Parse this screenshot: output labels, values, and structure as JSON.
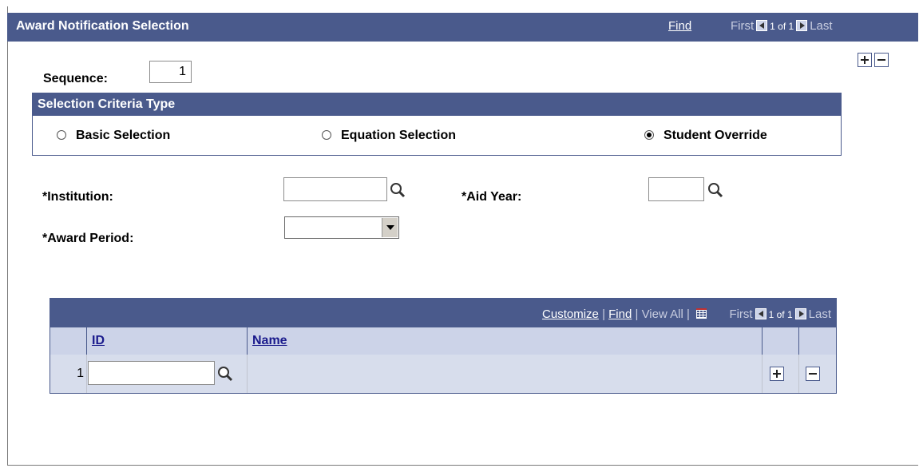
{
  "header": {
    "title": "Award Notification Selection",
    "find": "Find",
    "first": "First",
    "count": "1 of 1",
    "last": "Last"
  },
  "sequence": {
    "label": "Sequence:",
    "value": "1"
  },
  "criteria": {
    "title": "Selection Criteria Type",
    "options": [
      {
        "label": "Basic Selection",
        "selected": false
      },
      {
        "label": "Equation Selection",
        "selected": false
      },
      {
        "label": "Student Override",
        "selected": true
      }
    ]
  },
  "form": {
    "institution_label": "*Institution:",
    "institution_value": "",
    "aid_year_label": "*Aid Year:",
    "aid_year_value": "",
    "award_period_label": "*Award Period:",
    "award_period_value": ""
  },
  "grid": {
    "customize": "Customize",
    "find": "Find",
    "view_all": "View All",
    "first": "First",
    "count": "1 of 1",
    "last": "Last",
    "columns": {
      "id": "ID",
      "name": "Name"
    },
    "rows": [
      {
        "num": "1",
        "id": "",
        "name": ""
      }
    ]
  },
  "colors": {
    "header_bg": "#4a5a8c",
    "col_header_bg": "#ccd3e8",
    "row_bg": "#d7ddec"
  }
}
